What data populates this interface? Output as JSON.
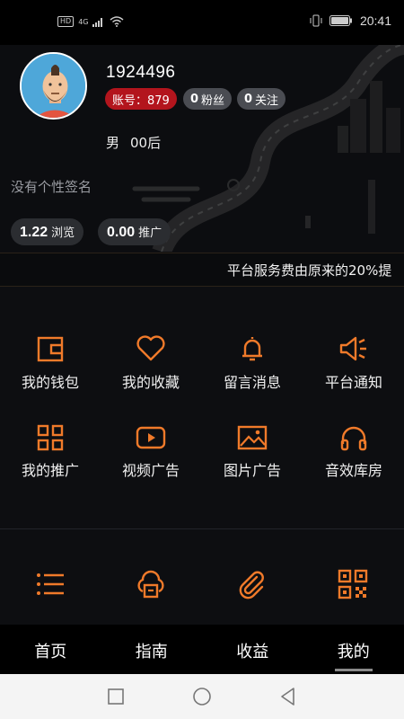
{
  "status_bar": {
    "hd": "HD",
    "network": "4G",
    "time": "20:41"
  },
  "profile": {
    "user_id": "1924496",
    "account_label": "账号：879",
    "fans_count": "0",
    "fans_label": "粉丝",
    "follow_count": "0",
    "follow_label": "关注",
    "gender": "男",
    "age_group": "00后",
    "signature": "没有个性签名",
    "views_value": "1.22",
    "views_label": "浏览",
    "promo_value": "0.00",
    "promo_label": "推广"
  },
  "marquee": {
    "text": "平台服务费由原来的20%提"
  },
  "menu": [
    {
      "label": "我的钱包",
      "icon": "wallet-icon"
    },
    {
      "label": "我的收藏",
      "icon": "heart-icon"
    },
    {
      "label": "留言消息",
      "icon": "bell-icon"
    },
    {
      "label": "平台通知",
      "icon": "speaker-icon"
    },
    {
      "label": "我的推广",
      "icon": "grid-icon"
    },
    {
      "label": "视频广告",
      "icon": "video-icon"
    },
    {
      "label": "图片广告",
      "icon": "image-icon"
    },
    {
      "label": "音效库房",
      "icon": "headphones-icon"
    }
  ],
  "tools": [
    "list-icon",
    "cloud-storage-icon",
    "paperclip-icon",
    "qrcode-icon"
  ],
  "bottom_nav": [
    {
      "label": "首页"
    },
    {
      "label": "指南"
    },
    {
      "label": "收益"
    },
    {
      "label": "我的"
    }
  ],
  "colors": {
    "accent": "#f07a2a",
    "account_badge": "#b3151d"
  }
}
